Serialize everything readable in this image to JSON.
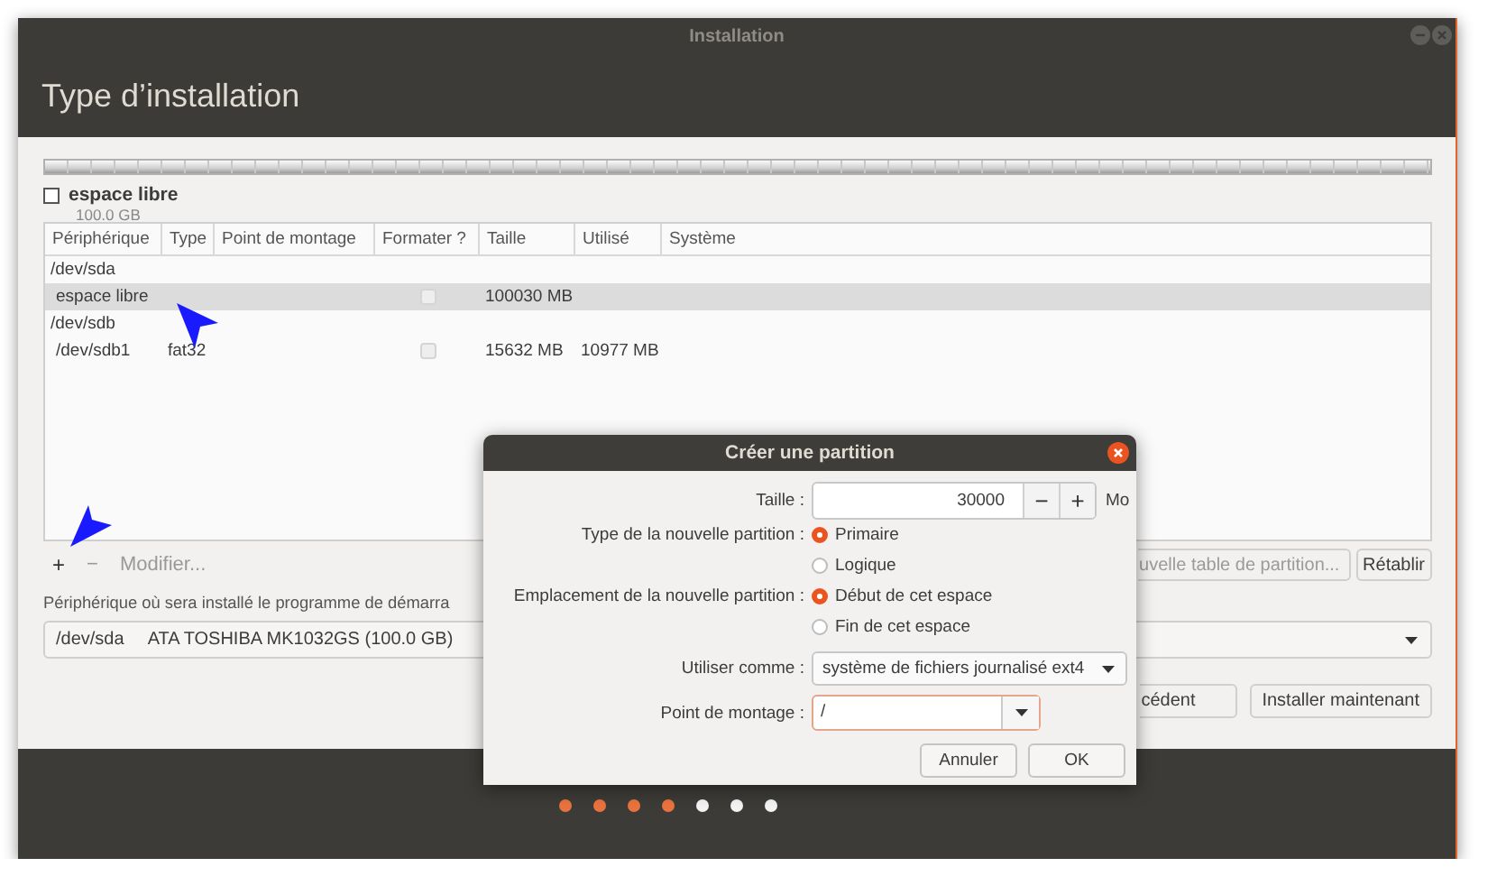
{
  "window": {
    "title": "Installation"
  },
  "header": {
    "title": "Type d’installation"
  },
  "disk_bar": {
    "legend": [
      {
        "label": "espace libre",
        "size": "100.0 GB"
      }
    ]
  },
  "partition_table": {
    "columns": [
      "Périphérique",
      "Type",
      "Point de montage",
      "Formater ?",
      "Taille",
      "Utilisé",
      "Système"
    ],
    "rows": [
      {
        "kind": "device",
        "device": "/dev/sda",
        "selected": false
      },
      {
        "kind": "partition",
        "device": "espace libre",
        "type": "",
        "size": "100030 MB",
        "used": "",
        "format": false,
        "selected": true
      },
      {
        "kind": "device",
        "device": "/dev/sdb",
        "selected": false
      },
      {
        "kind": "partition",
        "device": "/dev/sdb1",
        "type": "fat32",
        "size": "15632 MB",
        "used": "10977 MB",
        "format": false,
        "selected": false
      }
    ]
  },
  "table_actions": [
    {
      "label": "+",
      "disabled": false
    },
    {
      "label": "−",
      "disabled": true
    },
    {
      "label": "Modifier...",
      "disabled": true
    }
  ],
  "partition_buttons": [
    "uvelle table de partition...",
    "Rétablir"
  ],
  "bootloader": {
    "label": "Périphérique où sera installé le programme de démarra",
    "device": "/dev/sda",
    "description": "ATA TOSHIBA MK1032GS (100.0 GB)"
  },
  "nav_buttons": [
    "cédent",
    "Installer maintenant"
  ],
  "steps": [
    {
      "done": true
    },
    {
      "done": true
    },
    {
      "done": true
    },
    {
      "done": true
    },
    {
      "done": false
    },
    {
      "done": false
    },
    {
      "done": false
    }
  ],
  "dialog": {
    "title": "Créer une partition",
    "size": {
      "label": "Taille :",
      "value": "30000",
      "minus": "−",
      "plus": "+",
      "unit": "Mo"
    },
    "partition_type": {
      "label": "Type de la nouvelle partition :",
      "options": [
        {
          "label": "Primaire",
          "selected": true
        },
        {
          "label": "Logique",
          "selected": false
        }
      ]
    },
    "location": {
      "label": "Emplacement de la nouvelle partition :",
      "options": [
        {
          "label": "Début de cet espace",
          "selected": true
        },
        {
          "label": "Fin de cet espace",
          "selected": false
        }
      ]
    },
    "use_as": {
      "label": "Utiliser comme :",
      "value": "système de fichiers journalisé ext4"
    },
    "mount_point": {
      "label": "Point de montage :",
      "value": "/"
    },
    "buttons": [
      "Annuler",
      "OK"
    ]
  }
}
